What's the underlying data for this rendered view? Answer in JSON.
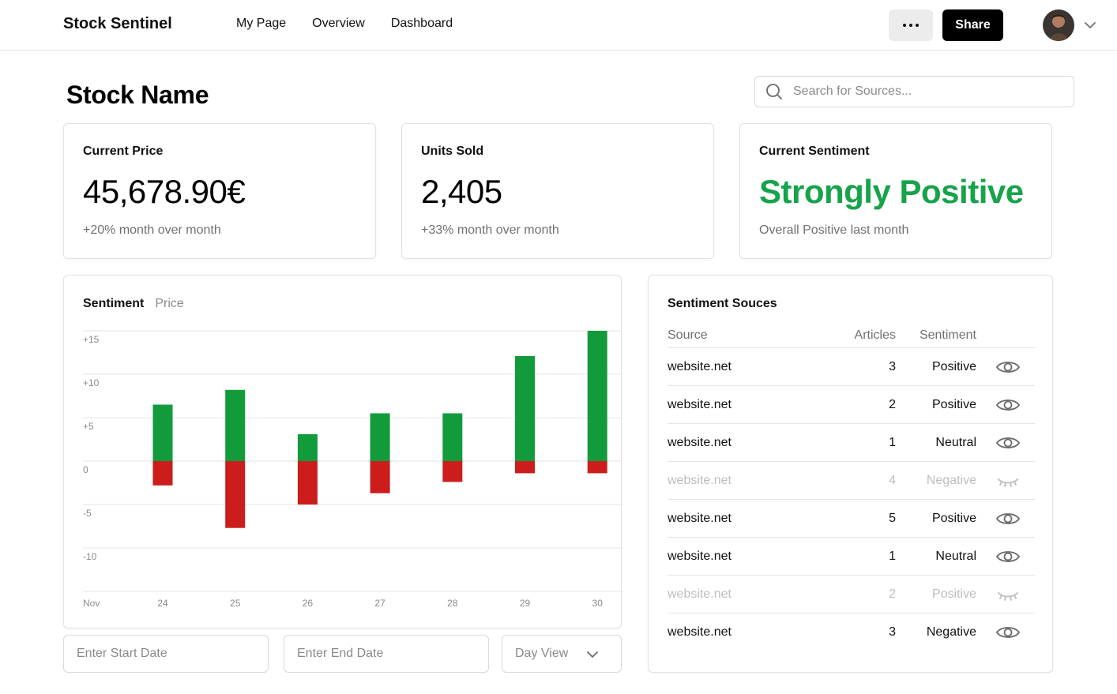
{
  "app": {
    "brand": "Stock Sentinel"
  },
  "nav": {
    "items": [
      "My Page",
      "Overview",
      "Dashboard"
    ]
  },
  "header": {
    "share_label": "Share"
  },
  "page": {
    "title": "Stock Name"
  },
  "search": {
    "placeholder": "Search for Sources..."
  },
  "stats": [
    {
      "title": "Current Price",
      "value": "45,678.90€",
      "sub": "+20% month over month"
    },
    {
      "title": "Units Sold",
      "value": "2,405",
      "sub": "+33% month over month"
    },
    {
      "title": "Current Sentiment",
      "value": "Strongly Positive",
      "sub": "Overall Positive last month"
    }
  ],
  "chart_tabs": {
    "active": "Sentiment",
    "inactive": "Price"
  },
  "colors": {
    "positive": "#16a34a",
    "negative": "#cc1f1f",
    "bar_positive": "#129b3b",
    "bar_negative": "#cc1c1c"
  },
  "chart_data": {
    "type": "bar",
    "stacked": "diverging",
    "x_prefix": "Nov",
    "categories": [
      "24",
      "25",
      "26",
      "27",
      "28",
      "29",
      "30"
    ],
    "series": [
      {
        "values": [
          6.5,
          8.2,
          3.1,
          5.5,
          5.5,
          12.1,
          15.0
        ]
      },
      {
        "values": [
          -2.8,
          -7.7,
          -5.0,
          -3.7,
          -2.4,
          -1.4,
          -1.4
        ]
      }
    ],
    "yticks": [
      "+15",
      "+10",
      "+5",
      "0",
      "-5",
      "-10"
    ],
    "ytick_values": [
      15,
      10,
      5,
      0,
      -5,
      -10
    ],
    "ylim": [
      -15,
      15
    ],
    "grid": true
  },
  "dates": {
    "start_placeholder": "Enter Start Date",
    "end_placeholder": "Enter End Date"
  },
  "view_select": {
    "value": "Day View"
  },
  "sources": {
    "title": "Sentiment Souces",
    "headers": {
      "source": "Source",
      "articles": "Articles",
      "sentiment": "Sentiment"
    },
    "rows": [
      {
        "source": "website.net",
        "articles": "3",
        "sentiment": "Positive",
        "visible": true
      },
      {
        "source": "website.net",
        "articles": "2",
        "sentiment": "Positive",
        "visible": true
      },
      {
        "source": "website.net",
        "articles": "1",
        "sentiment": "Neutral",
        "visible": true
      },
      {
        "source": "website.net",
        "articles": "4",
        "sentiment": "Negative",
        "visible": false
      },
      {
        "source": "website.net",
        "articles": "5",
        "sentiment": "Positive",
        "visible": true
      },
      {
        "source": "website.net",
        "articles": "1",
        "sentiment": "Neutral",
        "visible": true
      },
      {
        "source": "website.net",
        "articles": "2",
        "sentiment": "Positive",
        "visible": false
      },
      {
        "source": "website.net",
        "articles": "3",
        "sentiment": "Negative",
        "visible": true
      }
    ]
  }
}
